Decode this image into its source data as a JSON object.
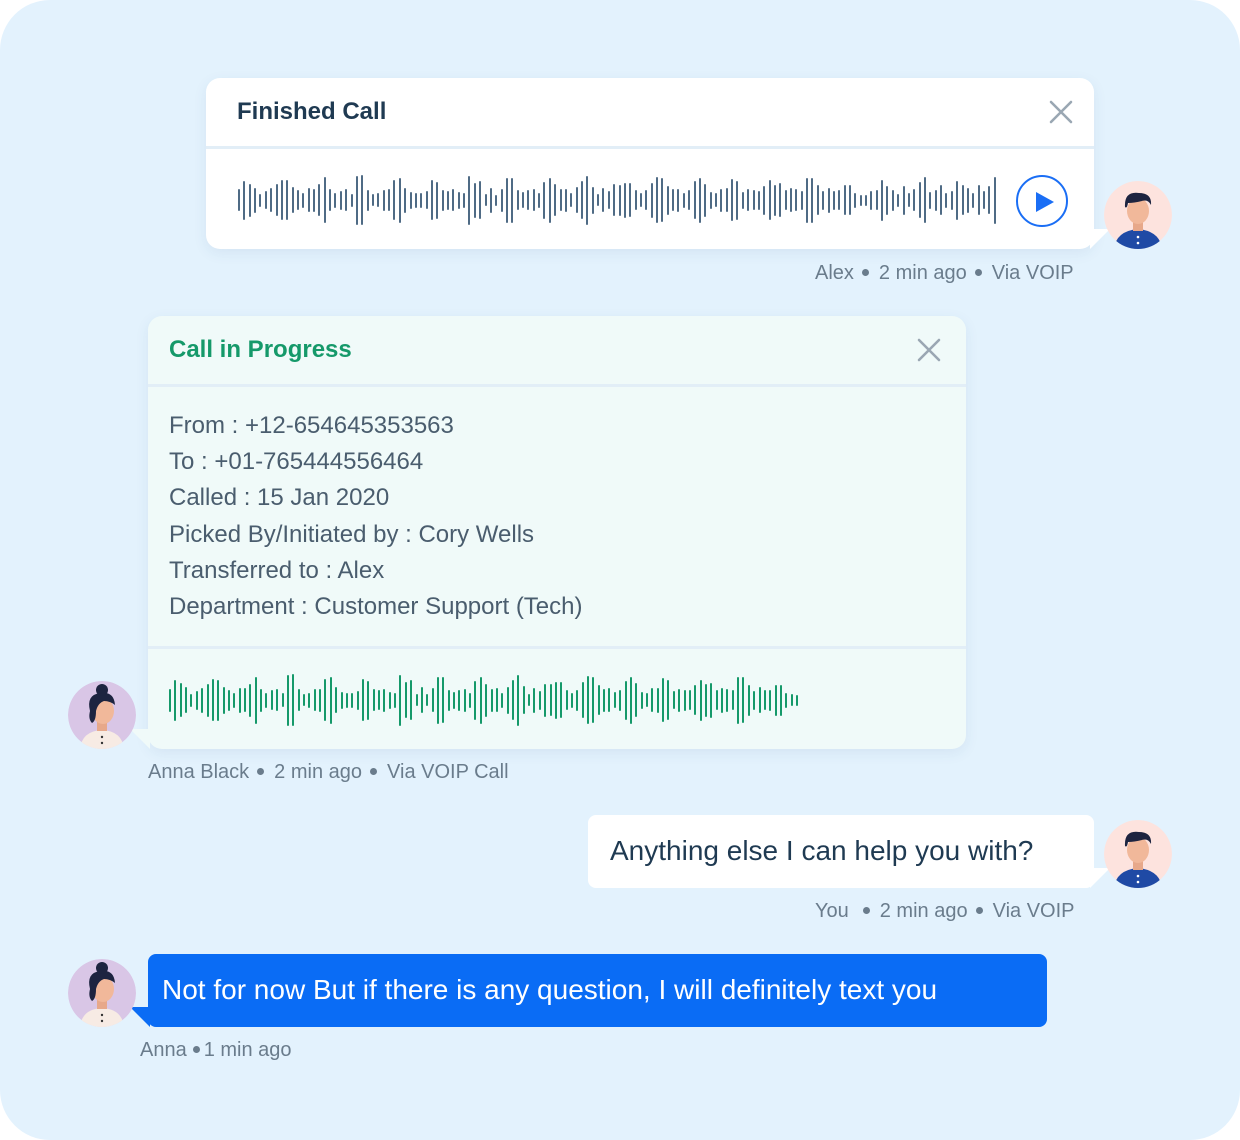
{
  "finished_call": {
    "title": "Finished Call",
    "meta": {
      "sender": "Alex",
      "time": "2 min ago",
      "channel": "Via VOIP"
    }
  },
  "call_in_progress": {
    "title": "Call in Progress",
    "details": [
      "From : +12-654645353563",
      "To : +01-765444556464",
      "Called : 15 Jan 2020",
      "Picked By/Initiated by : Cory Wells",
      "Transferred to : Alex",
      "Department : Customer Support (Tech)"
    ],
    "meta": {
      "sender": "Anna Black",
      "time": "2 min ago",
      "channel": "Via VOIP Call"
    }
  },
  "agent_message": {
    "text": "Anything else I can help you with?",
    "meta": {
      "sender": "You",
      "time": "2 min ago",
      "channel": "Via VOIP"
    }
  },
  "customer_message": {
    "text": "Not for now But if there is any question, I will definitely text you",
    "meta": {
      "sender": "Anna",
      "time": "1 min ago"
    }
  },
  "colors": {
    "background": "#e3f2fd",
    "accent_blue": "#1a6ef5",
    "accent_green": "#15996a",
    "waveform_gray": "#4f6b85",
    "heading_dark": "#1f3a52"
  },
  "icons": [
    "close-icon",
    "play-icon",
    "male-avatar-icon",
    "female-avatar-icon"
  ]
}
